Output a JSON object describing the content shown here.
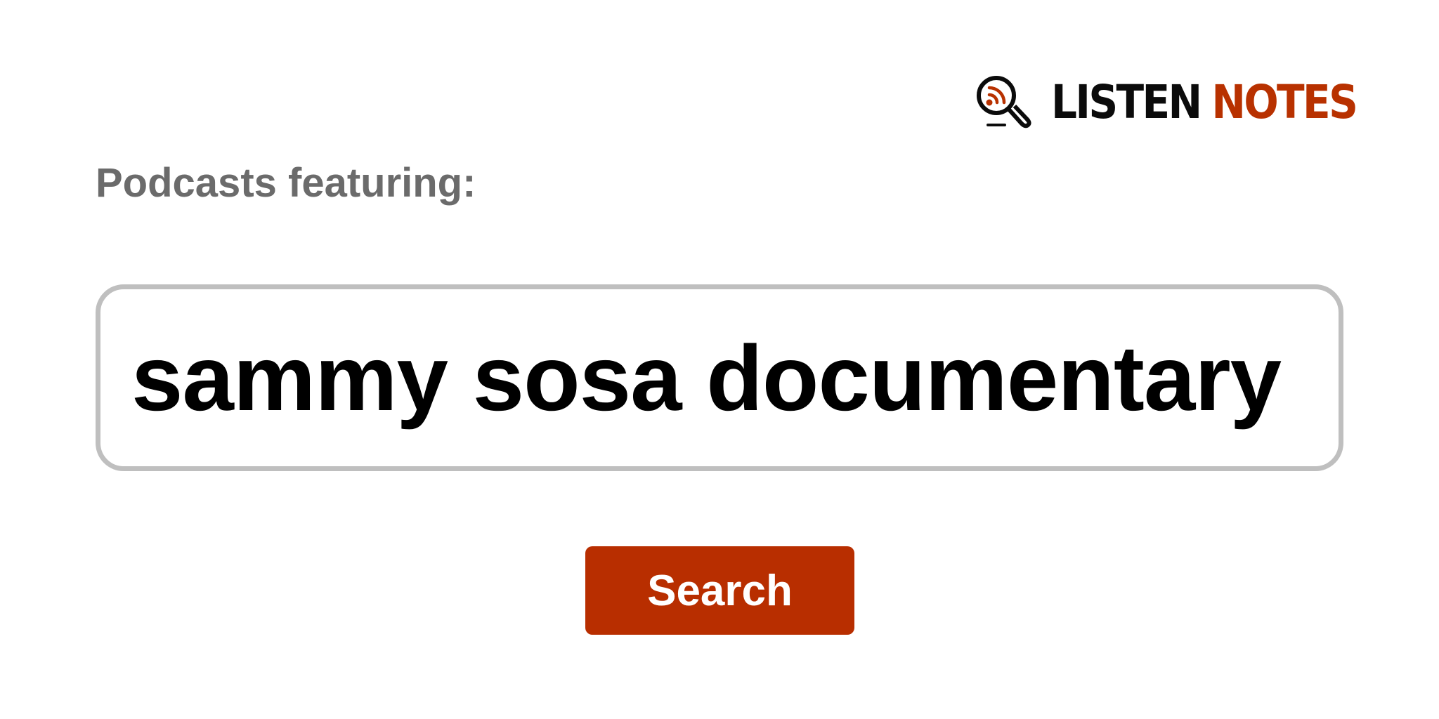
{
  "logo": {
    "word_1": "LISTEN",
    "word_2": "NOTES",
    "icon": "podcast-magnifier-icon",
    "color_dark": "#0b0b0b",
    "color_accent": "#b83100"
  },
  "heading": "Podcasts featuring:",
  "search": {
    "value": "sammy sosa documentary",
    "border_color": "#bfbfbf"
  },
  "button": {
    "label": "Search",
    "color": "#b82e00"
  }
}
